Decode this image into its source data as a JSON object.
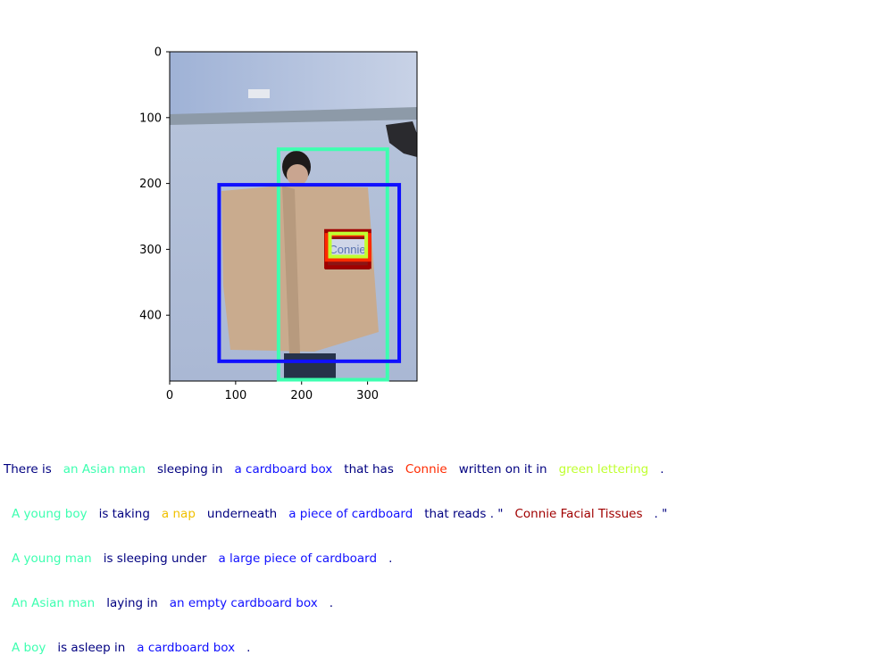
{
  "axes": {
    "y_ticks": [
      "0",
      "100",
      "200",
      "300",
      "400"
    ],
    "x_ticks": [
      "0",
      "100",
      "200",
      "300"
    ],
    "y_values": [
      0,
      100,
      200,
      300,
      400
    ],
    "x_values": [
      0,
      100,
      200,
      300
    ],
    "xlim": [
      0,
      375
    ],
    "ylim": [
      500,
      0
    ]
  },
  "boxes": [
    {
      "name": "asian-man",
      "color": "#3dffb0",
      "x0": 165,
      "y0": 148,
      "x1": 330,
      "y1": 498
    },
    {
      "name": "cardboard-box",
      "color": "#1010ff",
      "x0": 75,
      "y0": 202,
      "x1": 348,
      "y1": 470
    },
    {
      "name": "connie-facial-tissues",
      "color": "#a00000",
      "x0": 237,
      "y0": 272,
      "x1": 303,
      "y1": 327
    },
    {
      "name": "connie-text",
      "color": "#ff2a00",
      "x0": 238,
      "y0": 278,
      "x1": 303,
      "y1": 316
    },
    {
      "name": "green-lettering",
      "color": "#c0ff30",
      "x0": 243,
      "y0": 276,
      "x1": 298,
      "y1": 311
    }
  ],
  "captions": [
    [
      {
        "text": "There is",
        "color": "#000080"
      },
      {
        "text": "an Asian man",
        "color": "#3dffb0"
      },
      {
        "text": "sleeping in",
        "color": "#000080"
      },
      {
        "text": "a cardboard box",
        "color": "#1010ff"
      },
      {
        "text": "that has",
        "color": "#000080"
      },
      {
        "text": "Connie",
        "color": "#ff2a00"
      },
      {
        "text": "written on it in",
        "color": "#000080"
      },
      {
        "text": "green lettering",
        "color": "#c0ff30"
      },
      {
        "text": ".",
        "color": "#000080"
      }
    ],
    [
      {
        "text": "A young boy",
        "color": "#3dffb0"
      },
      {
        "text": "is taking",
        "color": "#000080"
      },
      {
        "text": "a nap",
        "color": "#f0c000"
      },
      {
        "text": "underneath",
        "color": "#000080"
      },
      {
        "text": "a piece of cardboard",
        "color": "#1010ff"
      },
      {
        "text": "that reads . \"",
        "color": "#000080"
      },
      {
        "text": "Connie Facial Tissues",
        "color": "#a00000"
      },
      {
        "text": ". \"",
        "color": "#000080"
      }
    ],
    [
      {
        "text": "A young man",
        "color": "#3dffb0"
      },
      {
        "text": "is sleeping under",
        "color": "#000080"
      },
      {
        "text": "a large piece of cardboard",
        "color": "#1010ff"
      },
      {
        "text": ".",
        "color": "#000080"
      }
    ],
    [
      {
        "text": "An Asian man",
        "color": "#3dffb0"
      },
      {
        "text": "laying in",
        "color": "#000080"
      },
      {
        "text": "an empty cardboard box",
        "color": "#1010ff"
      },
      {
        "text": ".",
        "color": "#000080"
      }
    ],
    [
      {
        "text": "A boy",
        "color": "#3dffb0"
      },
      {
        "text": "is asleep in",
        "color": "#000080"
      },
      {
        "text": "a cardboard box",
        "color": "#1010ff"
      },
      {
        "text": ".",
        "color": "#000080"
      }
    ]
  ]
}
